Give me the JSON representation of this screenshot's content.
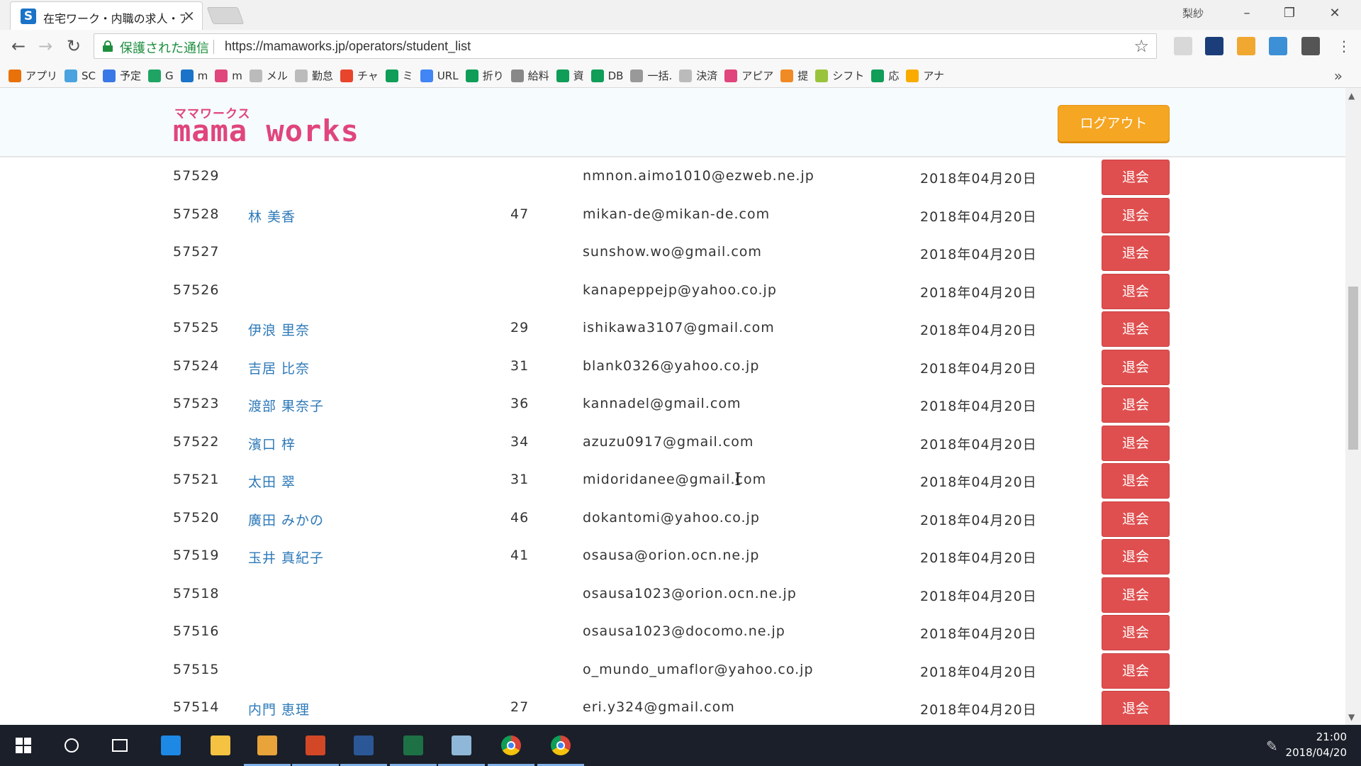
{
  "browser": {
    "tab_title": "在宅ワーク・内職の求人・ア",
    "tab_favicon": "S",
    "user_label": "梨紗",
    "secure_label": "保護された通信",
    "url": "https://mamaworks.jp/operators/student_list"
  },
  "bookmarks": [
    {
      "label": "アプリ",
      "icon": "apps-grid-icon",
      "color": "#e8710a"
    },
    {
      "label": "SC",
      "icon": "sc-icon",
      "color": "#4aa3df"
    },
    {
      "label": "予定",
      "icon": "calendar-icon",
      "color": "#3b78e7"
    },
    {
      "label": "G",
      "icon": "drive-icon",
      "color": "#1fa463"
    },
    {
      "label": "m",
      "icon": "s-logo-icon",
      "color": "#1a73c8"
    },
    {
      "label": "m",
      "icon": "gift-icon",
      "color": "#e0457b"
    },
    {
      "label": "メル",
      "icon": "page-icon",
      "color": "#bbbbbb"
    },
    {
      "label": "勤怠",
      "icon": "page-icon",
      "color": "#bbbbbb"
    },
    {
      "label": "チャ",
      "icon": "chat-icon",
      "color": "#e8452c"
    },
    {
      "label": "ミ",
      "icon": "sheets-icon",
      "color": "#0f9d58"
    },
    {
      "label": "URL",
      "icon": "google-icon",
      "color": "#4285f4"
    },
    {
      "label": "折り",
      "icon": "sheets-icon",
      "color": "#0f9d58"
    },
    {
      "label": "給料",
      "icon": "globe-icon",
      "color": "#888888"
    },
    {
      "label": "資",
      "icon": "sheets-icon",
      "color": "#0f9d58"
    },
    {
      "label": "DB",
      "icon": "sheets-icon",
      "color": "#0f9d58"
    },
    {
      "label": "一括.",
      "icon": "dash-icon",
      "color": "#999999"
    },
    {
      "label": "決済",
      "icon": "page-icon",
      "color": "#bbbbbb"
    },
    {
      "label": "アピア",
      "icon": "heart-icon",
      "color": "#e0457b"
    },
    {
      "label": "提",
      "icon": "circle-icon",
      "color": "#f08a24"
    },
    {
      "label": "シフト",
      "icon": "star-icon",
      "color": "#9ac33c"
    },
    {
      "label": "応",
      "icon": "sheets-icon",
      "color": "#0f9d58"
    },
    {
      "label": "アナ",
      "icon": "analytics-icon",
      "color": "#f9ab00"
    }
  ],
  "header": {
    "logo_kana": "ママワークス",
    "logo_text": "mama works",
    "logout_label": "ログアウト"
  },
  "students": [
    {
      "id": "57529",
      "name": "",
      "age": "",
      "email": "nmnon.aimo1010@ezweb.ne.jp",
      "date": "2018年04月20日",
      "action": "退会"
    },
    {
      "id": "57528",
      "name": "林 美香",
      "age": "47",
      "email": "mikan-de@mikan-de.com",
      "date": "2018年04月20日",
      "action": "退会"
    },
    {
      "id": "57527",
      "name": "",
      "age": "",
      "email": "sunshow.wo@gmail.com",
      "date": "2018年04月20日",
      "action": "退会"
    },
    {
      "id": "57526",
      "name": "",
      "age": "",
      "email": "kanapeppejp@yahoo.co.jp",
      "date": "2018年04月20日",
      "action": "退会"
    },
    {
      "id": "57525",
      "name": "伊浪 里奈",
      "age": "29",
      "email": "ishikawa3107@gmail.com",
      "date": "2018年04月20日",
      "action": "退会"
    },
    {
      "id": "57524",
      "name": "吉居 比奈",
      "age": "31",
      "email": "blank0326@yahoo.co.jp",
      "date": "2018年04月20日",
      "action": "退会"
    },
    {
      "id": "57523",
      "name": "渡部 果奈子",
      "age": "36",
      "email": "kannadel@gmail.com",
      "date": "2018年04月20日",
      "action": "退会"
    },
    {
      "id": "57522",
      "name": "濱口 梓",
      "age": "34",
      "email": "azuzu0917@gmail.com",
      "date": "2018年04月20日",
      "action": "退会"
    },
    {
      "id": "57521",
      "name": "太田 翠",
      "age": "31",
      "email": "midoridanee@gmail.com",
      "date": "2018年04月20日",
      "action": "退会"
    },
    {
      "id": "57520",
      "name": "廣田 みかの",
      "age": "46",
      "email": "dokantomi@yahoo.co.jp",
      "date": "2018年04月20日",
      "action": "退会"
    },
    {
      "id": "57519",
      "name": "玉井 真紀子",
      "age": "41",
      "email": "osausa@orion.ocn.ne.jp",
      "date": "2018年04月20日",
      "action": "退会"
    },
    {
      "id": "57518",
      "name": "",
      "age": "",
      "email": "osausa1023@orion.ocn.ne.jp",
      "date": "2018年04月20日",
      "action": "退会"
    },
    {
      "id": "57516",
      "name": "",
      "age": "",
      "email": "osausa1023@docomo.ne.jp",
      "date": "2018年04月20日",
      "action": "退会"
    },
    {
      "id": "57515",
      "name": "",
      "age": "",
      "email": "o_mundo_umaflor@yahoo.co.jp",
      "date": "2018年04月20日",
      "action": "退会"
    },
    {
      "id": "57514",
      "name": "内門 恵理",
      "age": "27",
      "email": "eri.y324@gmail.com",
      "date": "2018年04月20日",
      "action": "退会"
    }
  ],
  "taskbar": {
    "apps": [
      "start-icon",
      "cortana-icon",
      "task-view-icon",
      "edge-icon",
      "file-explorer-icon",
      "outlook-icon",
      "powerpoint-icon",
      "word-icon",
      "excel-icon",
      "notes-icon",
      "chrome-profile-icon",
      "chrome-icon"
    ],
    "time": "21:00",
    "date": "2018/04/20"
  }
}
